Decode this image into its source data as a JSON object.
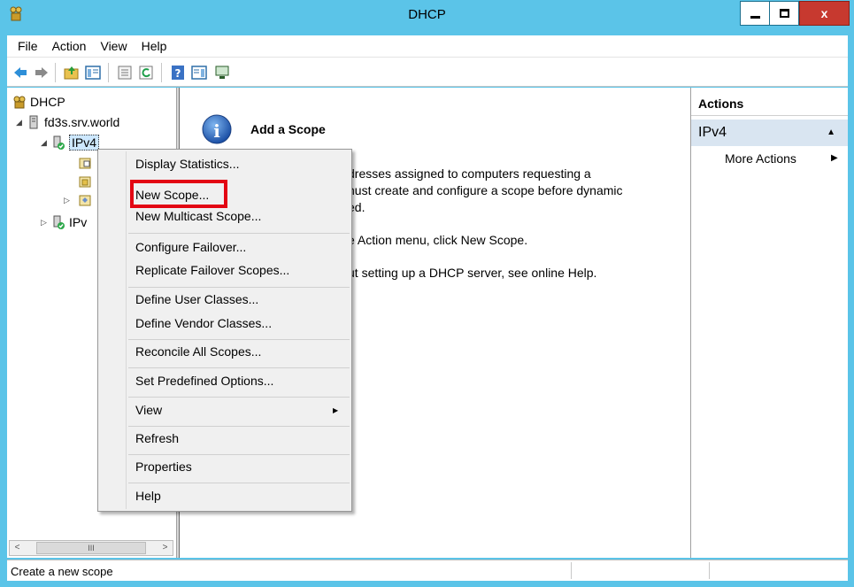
{
  "window": {
    "title": "DHCP",
    "close_glyph": "x",
    "colors": {
      "titlebar": "#5bc4e8",
      "close": "#c7392f",
      "highlight": "#e30613"
    }
  },
  "menubar": [
    "File",
    "Action",
    "View",
    "Help"
  ],
  "toolbar": {
    "icons": [
      "back-arrow-icon",
      "forward-arrow-icon",
      "up-folder-icon",
      "show-hide-tree-icon",
      "properties-icon",
      "refresh-icon",
      "help-icon",
      "show-hide-action-pane-icon",
      "monitor-icon"
    ]
  },
  "tree": {
    "root": "DHCP",
    "server": "fd3s.srv.world",
    "ipv4": "IPv4",
    "ipv6": "IPv",
    "scroll_thumb": "III"
  },
  "center": {
    "heading": "Add a Scope",
    "lines": [
      "dresses assigned to computers requesting a",
      "nust create and configure a scope before dynamic",
      "ed.",
      "e Action menu, click New Scope.",
      "ut setting up a DHCP server, see online Help."
    ]
  },
  "actions": {
    "header": "Actions",
    "section": "IPv4",
    "more": "More Actions"
  },
  "context_menu": {
    "items": [
      "Display Statistics...",
      "New Scope...",
      "New Multicast Scope...",
      "Configure Failover...",
      "Replicate Failover Scopes...",
      "Define User Classes...",
      "Define Vendor Classes...",
      "Reconcile All Scopes...",
      "Set Predefined Options...",
      "View",
      "Refresh",
      "Properties",
      "Help"
    ],
    "highlighted": "New Scope..."
  },
  "status": {
    "text": "Create a new scope"
  }
}
